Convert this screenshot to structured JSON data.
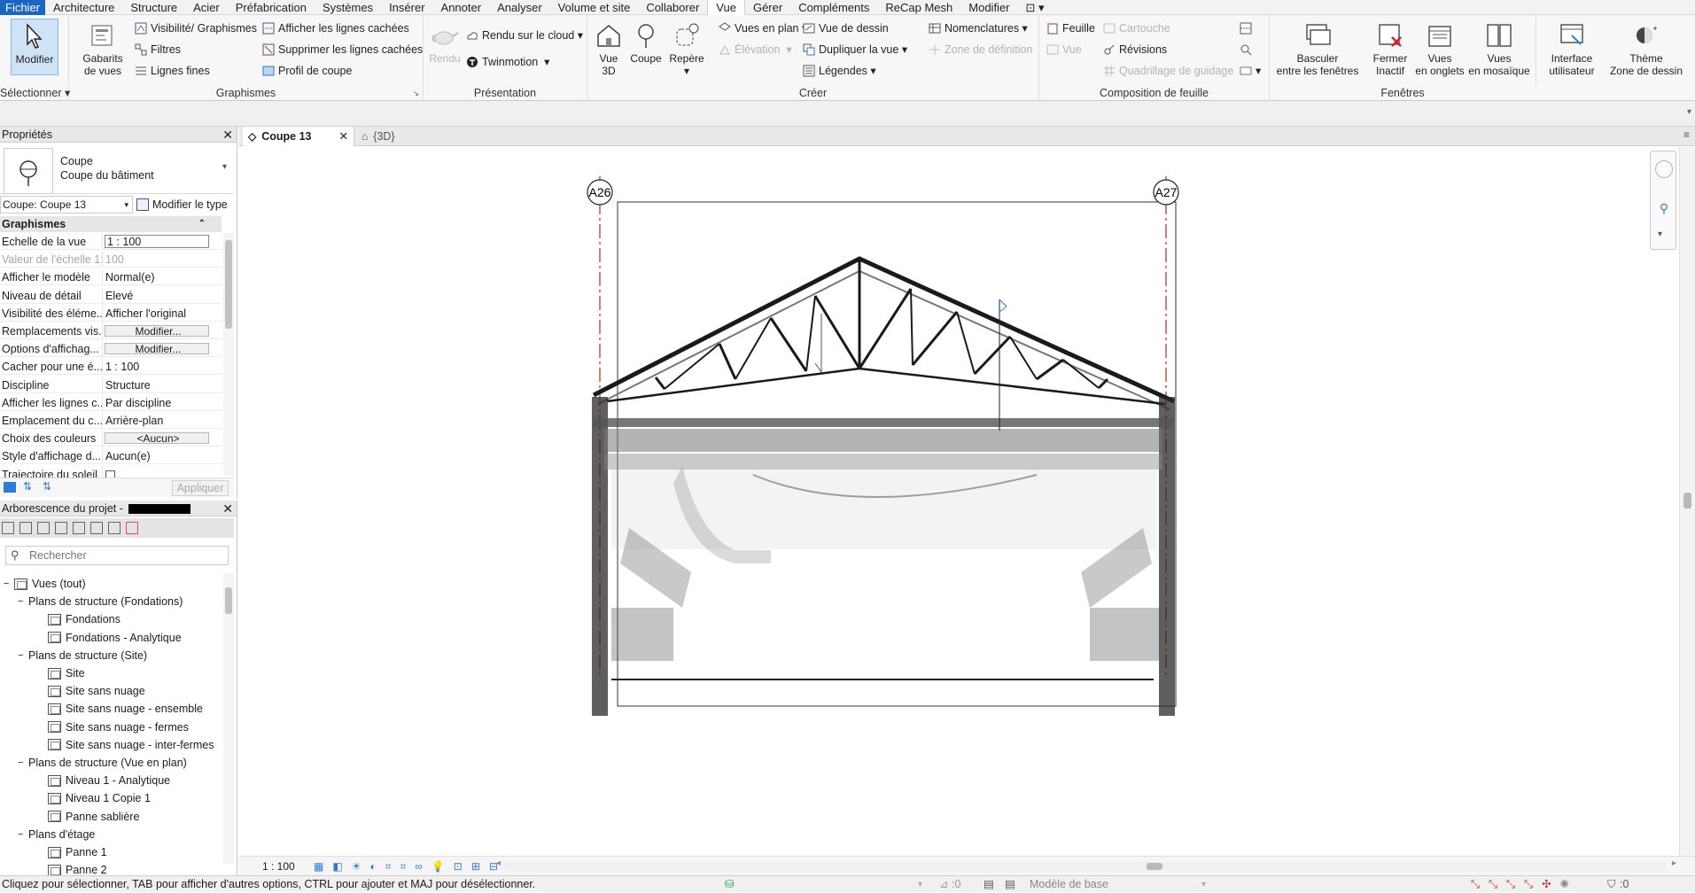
{
  "menu": [
    "Fichier",
    "Architecture",
    "Structure",
    "Acier",
    "Préfabrication",
    "Systèmes",
    "Insérer",
    "Annoter",
    "Analyser",
    "Volume et site",
    "Collaborer",
    "Vue",
    "Gérer",
    "Compléments",
    "ReCap Mesh",
    "Modifier"
  ],
  "menu_active": "Vue",
  "ribbon": {
    "modifier": "Modifier",
    "selectionner": "Sélectionner",
    "gabarits1": "Gabarits",
    "gabarits2": "de vues",
    "visibilite": "Visibilité/ Graphismes",
    "filtres": "Filtres",
    "lignes_fines": "Lignes fines",
    "afficher_lignes": "Afficher les lignes cachées",
    "supprimer_lignes": "Supprimer les lignes cachées",
    "profil_coupe": "Profil de coupe",
    "grp_graphismes": "Graphismes",
    "rendu": "Rendu",
    "rendu_cloud": "Rendu sur le cloud",
    "twinmotion": "Twinmotion",
    "grp_presentation": "Présentation",
    "vue3d1": "Vue",
    "vue3d2": "3D",
    "coupe": "Coupe",
    "repere": "Repère",
    "vues_plan": "Vues en plan",
    "elevation": "Élévation",
    "vue_dessin": "Vue de dessin",
    "dupliquer": "Dupliquer la vue",
    "legendes": "Légendes",
    "nomenclatures": "Nomenclatures",
    "zone_def": "Zone de définition",
    "grp_creer": "Créer",
    "feuille": "Feuille",
    "cartouche": "Cartouche",
    "vue": "Vue",
    "revisions": "Révisions",
    "quadrillage": "Quadrillage de guidage",
    "grp_composition": "Composition de feuille",
    "basculer1": "Basculer",
    "basculer2": "entre les fenêtres",
    "fermer1": "Fermer",
    "fermer2": "Inactif",
    "onglets1": "Vues",
    "onglets2": "en onglets",
    "mosaique1": "Vues",
    "mosaique2": "en mosaïque",
    "grp_fenetres": "Fenêtres",
    "interface1": "Interface",
    "interface2": "utilisateur",
    "theme1": "Thème",
    "theme2": "Zone de dessin"
  },
  "properties": {
    "title": "Propriétés",
    "type_name": "Coupe",
    "type_sub": "Coupe du bâtiment",
    "instance": "Coupe: Coupe 13",
    "edit_type": "Modifier le type",
    "section": "Graphismes",
    "rows": [
      {
        "k": "Echelle de la vue",
        "v": "1 : 100",
        "style": "boxed"
      },
      {
        "k": "Valeur de l'échelle    1:",
        "v": "100",
        "style": "dis"
      },
      {
        "k": "Afficher le modèle",
        "v": "Normal(e)",
        "style": ""
      },
      {
        "k": "Niveau de détail",
        "v": "Elevé",
        "style": ""
      },
      {
        "k": "Visibilité des éléme...",
        "v": "Afficher l'original",
        "style": ""
      },
      {
        "k": "Remplacements vis...",
        "v": "Modifier...",
        "style": "btnv"
      },
      {
        "k": "Options d'affichag...",
        "v": "Modifier...",
        "style": "btnv"
      },
      {
        "k": "Cacher pour une é...",
        "v": "1 : 100",
        "style": ""
      },
      {
        "k": "Discipline",
        "v": "Structure",
        "style": ""
      },
      {
        "k": "Afficher les lignes c...",
        "v": "Par discipline",
        "style": ""
      },
      {
        "k": "Emplacement du c...",
        "v": "Arrière-plan",
        "style": ""
      },
      {
        "k": "Choix des couleurs",
        "v": "<Aucun>",
        "style": "btnv"
      },
      {
        "k": "Style d'affichage d...",
        "v": "Aucun(e)",
        "style": ""
      },
      {
        "k": "Trajectoire du soleil",
        "v": "",
        "style": "check"
      }
    ],
    "apply": "Appliquer"
  },
  "browser": {
    "title": "Arborescence du projet -",
    "search_placeholder": "Rechercher",
    "items": [
      {
        "label": "Vues (tout)",
        "level": 0,
        "kind": "root"
      },
      {
        "label": "Plans de structure (Fondations)",
        "level": 1,
        "kind": "group"
      },
      {
        "label": "Fondations",
        "level": 2,
        "kind": "view"
      },
      {
        "label": "Fondations - Analytique",
        "level": 2,
        "kind": "view"
      },
      {
        "label": "Plans de structure (Site)",
        "level": 1,
        "kind": "group"
      },
      {
        "label": "Site",
        "level": 2,
        "kind": "view"
      },
      {
        "label": "Site sans nuage",
        "level": 2,
        "kind": "view"
      },
      {
        "label": "Site sans nuage - ensemble",
        "level": 2,
        "kind": "view"
      },
      {
        "label": "Site sans nuage - fermes",
        "level": 2,
        "kind": "view"
      },
      {
        "label": "Site sans nuage - inter-fermes",
        "level": 2,
        "kind": "view"
      },
      {
        "label": "Plans de structure (Vue en plan)",
        "level": 1,
        "kind": "group"
      },
      {
        "label": "Niveau 1 - Analytique",
        "level": 2,
        "kind": "view"
      },
      {
        "label": "Niveau 1 Copie 1",
        "level": 2,
        "kind": "view"
      },
      {
        "label": "Panne sablière",
        "level": 2,
        "kind": "view"
      },
      {
        "label": "Plans d'étage",
        "level": 1,
        "kind": "group"
      },
      {
        "label": "Panne 1",
        "level": 2,
        "kind": "view"
      },
      {
        "label": "Panne 2",
        "level": 2,
        "kind": "view"
      }
    ]
  },
  "tabs": [
    {
      "label": "Coupe 13",
      "active": true
    },
    {
      "label": "{3D}",
      "active": false
    }
  ],
  "grid_labels": [
    "A26",
    "A27"
  ],
  "view_scale": "1 : 100",
  "status": {
    "hint": "Cliquez pour sélectionner, TAB pour afficher d'autres options,  CTRL pour ajouter et MAJ pour désélectionner.",
    "count": ":0",
    "model": "Modèle de base",
    "filter": ":0"
  }
}
